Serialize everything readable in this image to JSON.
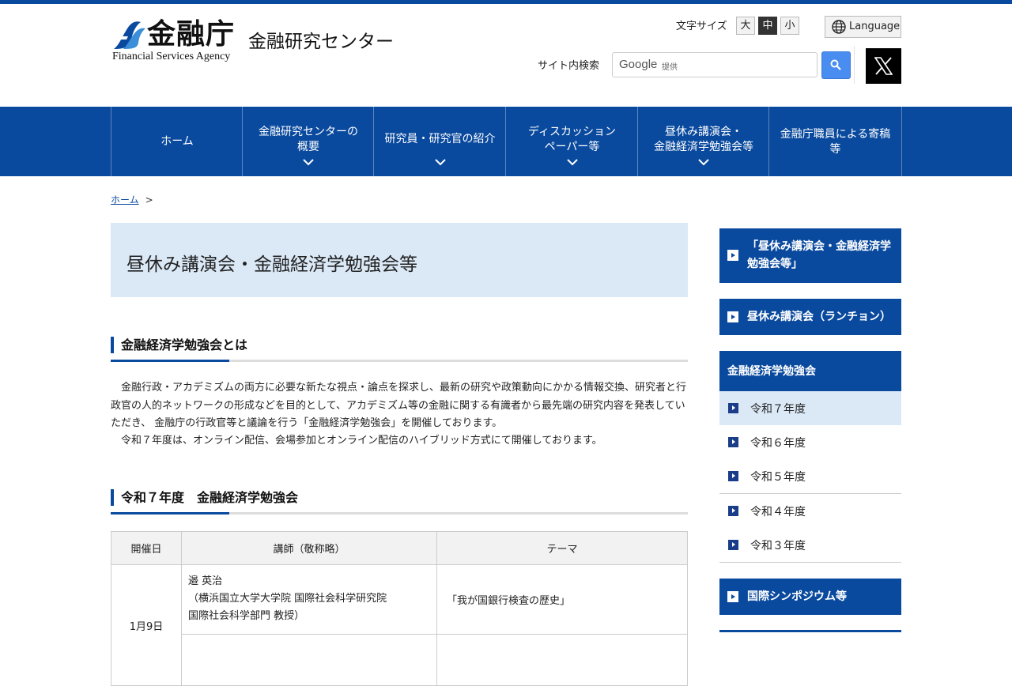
{
  "header": {
    "logo_text": "金融庁",
    "logo_en": "Financial Services Agency",
    "site_name": "金融研究センター",
    "font_size_label": "文字サイズ",
    "font_sizes": [
      "大",
      "中",
      "小"
    ],
    "font_size_selected": "中",
    "language_label": "Language",
    "search_label": "サイト内検索",
    "search_brand": "Google",
    "search_brand_suffix": "提供",
    "search_placeholder": ""
  },
  "nav": {
    "items": [
      {
        "label": "ホーム"
      },
      {
        "label": "金融研究センターの\n概要"
      },
      {
        "label": "研究員・研究官の紹介"
      },
      {
        "label": "ディスカッション\nペーパー等"
      },
      {
        "label": "昼休み講演会・\n金融経済学勉強会等"
      },
      {
        "label": "金融庁職員による寄稿\n等"
      }
    ]
  },
  "breadcrumb": {
    "home": "ホーム",
    "sep": ">"
  },
  "main": {
    "page_title": "昼休み講演会・金融経済学勉強会等",
    "section1_heading": "金融経済学勉強会とは",
    "section1_p1": "　金融行政・アカデミズムの両方に必要な新たな視点・論点を探求し、最新の研究や政策動向にかかる情報交換、研究者と行政官の人的ネットワークの形成などを目的として、アカデミズム等の金融に関する有識者から最先端の研究内容を発表していただき、 金融庁の行政官等と議論を行う「金融経済学勉強会」を開催しております。",
    "section1_p2": "　令和７年度は、オンライン配信、会場参加とオンライン配信のハイブリッド方式にて開催しております。",
    "section2_heading": "令和７年度　金融経済学勉強会",
    "table": {
      "headers": [
        "開催日",
        "講師（敬称略）",
        "テーマ"
      ],
      "rows": [
        {
          "date": "1月9日",
          "speaker_lines": [
            "邉 英治",
            "（横浜国立大学大学院 国際社会科学研究院",
            "国際社会科学部門 教授）"
          ],
          "theme": "「我が国銀行検査の歴史」"
        }
      ]
    }
  },
  "sidebar": {
    "block1": "「昼休み講演会・金融経済学\n勉強会等」",
    "block2": "昼休み講演会（ランチョン）",
    "section_head": "金融経済学勉強会",
    "years": [
      "令和７年度",
      "令和６年度",
      "令和５年度",
      "令和４年度",
      "令和３年度"
    ],
    "active_year": "令和７年度",
    "block3": "国際シンポジウム等"
  },
  "colors": {
    "brand_blue": "#0a4a9e",
    "title_bg": "#dbe9f7",
    "search_button": "#4a8df0"
  }
}
